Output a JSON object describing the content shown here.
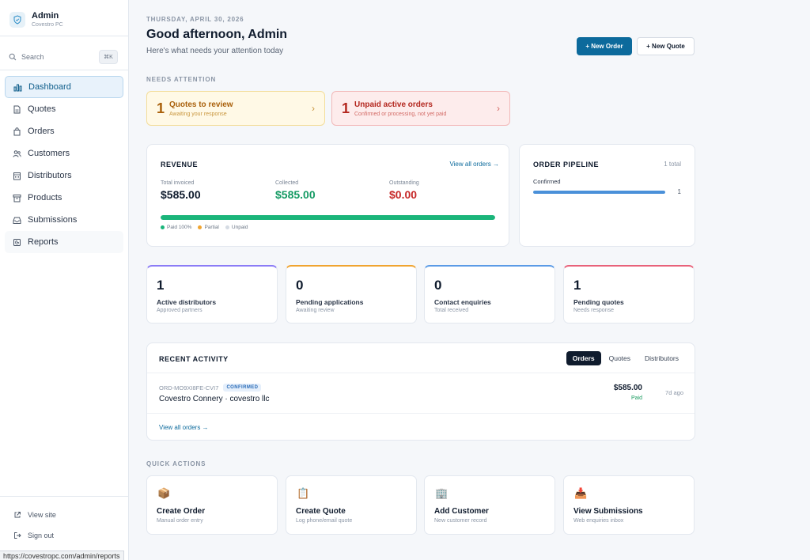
{
  "sidebar": {
    "brand_name": "Admin",
    "brand_sub": "Covestro PC",
    "search_label": "Search",
    "search_shortcut": "⌘K",
    "items": [
      {
        "label": "Dashboard",
        "icon": "bar-chart-icon"
      },
      {
        "label": "Quotes",
        "icon": "document-icon"
      },
      {
        "label": "Orders",
        "icon": "shopping-bag-icon"
      },
      {
        "label": "Customers",
        "icon": "users-icon"
      },
      {
        "label": "Distributors",
        "icon": "warehouse-icon"
      },
      {
        "label": "Products",
        "icon": "archive-icon"
      },
      {
        "label": "Submissions",
        "icon": "inbox-icon"
      },
      {
        "label": "Reports",
        "icon": "report-icon"
      }
    ],
    "view_site": "View site",
    "sign_out": "Sign out"
  },
  "statusbar_url": "https://covestropc.com/admin/reports",
  "header": {
    "date": "THURSDAY, APRIL 30, 2026",
    "greeting": "Good afternoon, Admin",
    "subtitle": "Here's what needs your attention today",
    "new_order": "+ New Order",
    "new_quote": "+ New Quote"
  },
  "attention": {
    "label": "NEEDS ATTENTION",
    "items": [
      {
        "count": "1",
        "title": "Quotes to review",
        "sub": "Awaiting your response"
      },
      {
        "count": "1",
        "title": "Unpaid active orders",
        "sub": "Confirmed or processing, not yet paid"
      }
    ]
  },
  "revenue": {
    "title": "REVENUE",
    "link": "View all orders →",
    "total_label": "Total invoiced",
    "total_value": "$585.00",
    "collected_label": "Collected",
    "collected_value": "$585.00",
    "outstanding_label": "Outstanding",
    "outstanding_value": "$0.00",
    "paid_fraction": 1.0,
    "legend_paid": "Paid 100%",
    "legend_partial": "Partial",
    "legend_unpaid": "Unpaid",
    "colors": {
      "paid": "#1ab57a",
      "partial": "#f0a430",
      "unpaid": "#d5dbe3",
      "outstanding": "#c62828",
      "collected": "#149a63"
    }
  },
  "pipeline": {
    "title": "ORDER PIPELINE",
    "total": "1 total",
    "stage_label": "Confirmed",
    "stage_count": "1",
    "stage_fraction": 1.0
  },
  "stats": [
    {
      "value": "1",
      "label": "Active distributors",
      "sub": "Approved partners",
      "color": "#8b7cf6"
    },
    {
      "value": "0",
      "label": "Pending applications",
      "sub": "Awaiting review",
      "color": "#f0a430"
    },
    {
      "value": "0",
      "label": "Contact enquiries",
      "sub": "Total received",
      "color": "#5b9be6"
    },
    {
      "value": "1",
      "label": "Pending quotes",
      "sub": "Needs response",
      "color": "#e8627a"
    }
  ],
  "activity": {
    "title": "RECENT ACTIVITY",
    "tabs": [
      "Orders",
      "Quotes",
      "Distributors"
    ],
    "row": {
      "id": "ORD-MO9XI8FE-CVI7",
      "badge": "CONFIRMED",
      "name": "Covestro Connery · covestro llc",
      "amount": "$585.00",
      "status": "Paid",
      "ago": "7d ago"
    },
    "view_all": "View all orders →"
  },
  "quick_actions": {
    "label": "QUICK ACTIONS",
    "items": [
      {
        "icon": "📦",
        "title": "Create Order",
        "sub": "Manual order entry"
      },
      {
        "icon": "📋",
        "title": "Create Quote",
        "sub": "Log phone/email quote"
      },
      {
        "icon": "🏢",
        "title": "Add Customer",
        "sub": "New customer record"
      },
      {
        "icon": "📥",
        "title": "View Submissions",
        "sub": "Web enquiries inbox"
      }
    ]
  }
}
